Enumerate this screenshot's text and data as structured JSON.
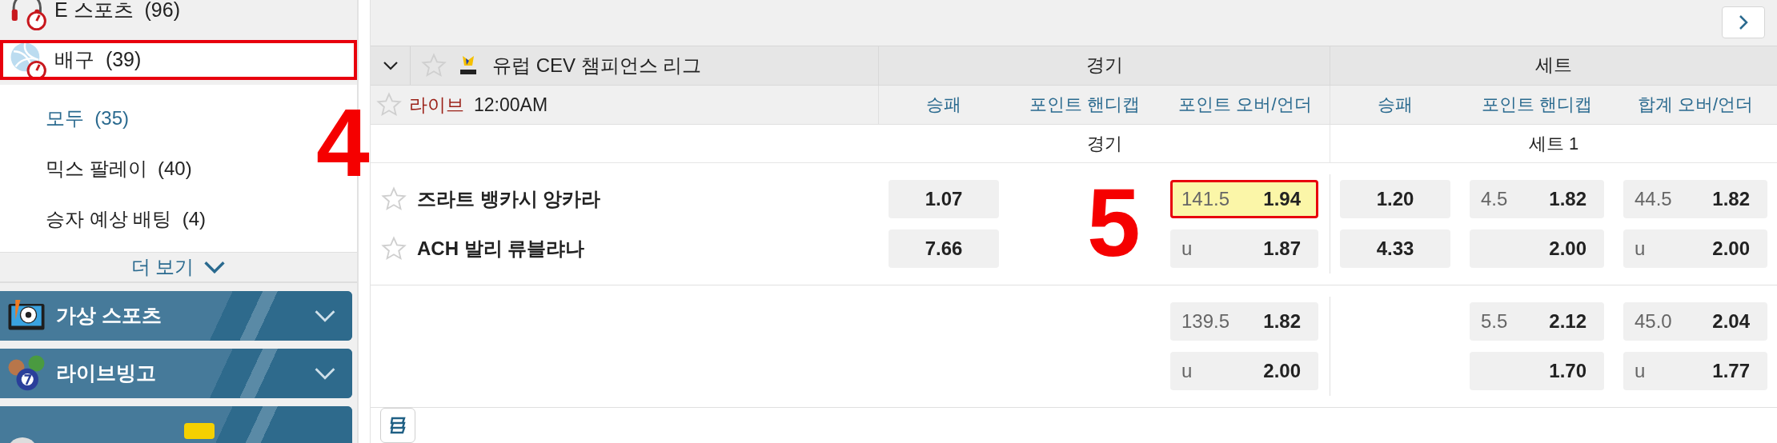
{
  "sidebar": {
    "sports": [
      {
        "label": "E 스포츠",
        "count": "(96)",
        "kind": "esports",
        "selected": false,
        "highlighted": false
      },
      {
        "label": "배구",
        "count": "(39)",
        "kind": "volleyball",
        "selected": true,
        "highlighted": true
      }
    ],
    "sub_items": [
      {
        "label": "모두",
        "count": "(35)",
        "selected": true
      },
      {
        "label": "믹스 팔레이",
        "count": "(40)",
        "selected": false
      },
      {
        "label": "승자 예상 배팅",
        "count": "(4)",
        "selected": false
      }
    ],
    "more_link": "더 보기",
    "banners": [
      {
        "label": "가상 스포츠",
        "kind": "virtual"
      },
      {
        "label": "라이브빙고",
        "kind": "bingo"
      },
      {
        "kind": "cut"
      }
    ]
  },
  "league": {
    "name": "유럽 CEV 챔피언스 리그",
    "expanded": true,
    "favorite": false
  },
  "groups": [
    {
      "label": "경기"
    },
    {
      "label": "세트"
    }
  ],
  "columns": [
    "승패",
    "포인트 핸디캡",
    "포인트 오버/언더",
    "승패",
    "포인트 핸디캡",
    "합계 오버/언더"
  ],
  "event": {
    "live_label": "라이브",
    "time": "12:00AM",
    "favorite": false,
    "periods": [
      "경기",
      "세트 1"
    ],
    "teams": [
      {
        "name": "즈라트 뱅카시 앙카라",
        "favorite": false
      },
      {
        "name": "ACH 발리 류블랴나",
        "favorite": false
      }
    ],
    "blocks": [
      {
        "rows": [
          [
            {
              "kind": "win",
              "odds": "1.07"
            },
            {
              "kind": "empty"
            },
            {
              "kind": "line",
              "line": "141.5",
              "odds": "1.94",
              "highlighted": true
            },
            {
              "kind": "win",
              "odds": "1.20"
            },
            {
              "kind": "line",
              "line": "4.5",
              "odds": "1.82"
            },
            {
              "kind": "line",
              "line": "44.5",
              "odds": "1.82"
            }
          ],
          [
            {
              "kind": "win",
              "odds": "7.66"
            },
            {
              "kind": "empty"
            },
            {
              "kind": "line",
              "line": "u",
              "odds": "1.87"
            },
            {
              "kind": "win",
              "odds": "4.33"
            },
            {
              "kind": "line",
              "odds": "2.00"
            },
            {
              "kind": "line",
              "line": "u",
              "odds": "2.00"
            }
          ]
        ]
      },
      {
        "rows": [
          [
            {
              "kind": "empty"
            },
            {
              "kind": "empty"
            },
            {
              "kind": "line",
              "line": "139.5",
              "odds": "1.82"
            },
            {
              "kind": "empty"
            },
            {
              "kind": "line",
              "line": "5.5",
              "odds": "2.12"
            },
            {
              "kind": "line",
              "line": "45.0",
              "odds": "2.04"
            }
          ],
          [
            {
              "kind": "empty"
            },
            {
              "kind": "empty"
            },
            {
              "kind": "line",
              "line": "u",
              "odds": "2.00"
            },
            {
              "kind": "empty"
            },
            {
              "kind": "line",
              "odds": "1.70"
            },
            {
              "kind": "line",
              "line": "u",
              "odds": "1.77"
            }
          ]
        ]
      }
    ]
  },
  "annotations": [
    {
      "label": "4"
    },
    {
      "label": "5"
    }
  ]
}
